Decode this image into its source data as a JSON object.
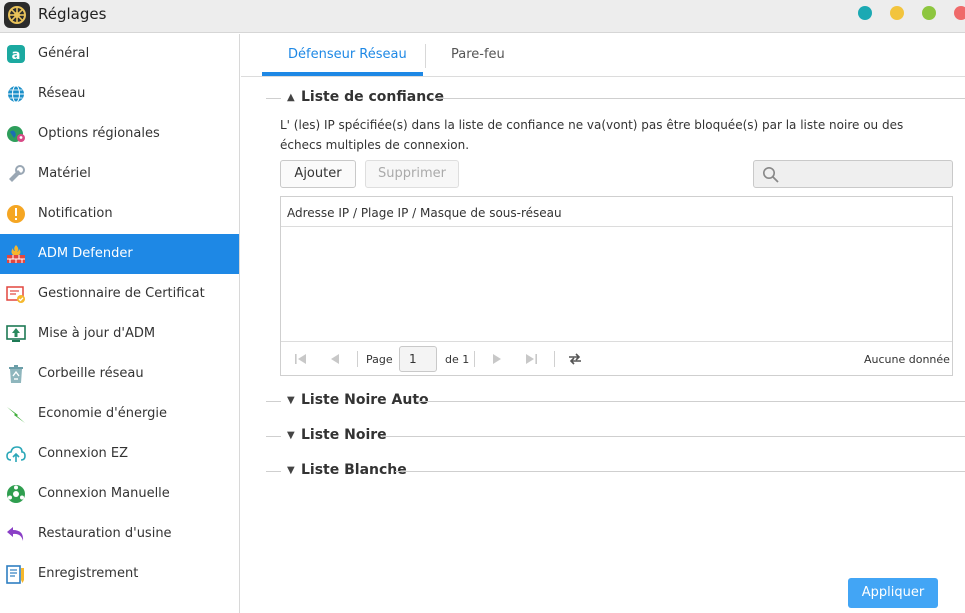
{
  "window": {
    "title": "Réglages",
    "controls": [
      {
        "name": "minimize-dot",
        "color": "#1ba9b3"
      },
      {
        "name": "maximize-dot",
        "color": "#f2c43d"
      },
      {
        "name": "fullscreen-dot",
        "color": "#8dc63f"
      },
      {
        "name": "close-dot",
        "color": "#ef6a6a"
      }
    ]
  },
  "colors": {
    "accent": "#1e88e5",
    "apply": "#42a5f5"
  },
  "sidebar": {
    "items": [
      {
        "label": "Général",
        "icon": "general-icon",
        "active": false
      },
      {
        "label": "Réseau",
        "icon": "globe-icon",
        "active": false
      },
      {
        "label": "Options régionales",
        "icon": "region-icon",
        "active": false
      },
      {
        "label": "Matériel",
        "icon": "hardware-icon",
        "active": false
      },
      {
        "label": "Notification",
        "icon": "notification-icon",
        "active": false
      },
      {
        "label": "ADM Defender",
        "icon": "firewall-icon",
        "active": true
      },
      {
        "label": "Gestionnaire de Certificat",
        "icon": "certificate-icon",
        "active": false
      },
      {
        "label": "Mise à jour d'ADM",
        "icon": "update-icon",
        "active": false
      },
      {
        "label": "Corbeille réseau",
        "icon": "recycle-bin-icon",
        "active": false
      },
      {
        "label": "Economie d'énergie",
        "icon": "energy-icon",
        "active": false
      },
      {
        "label": "Connexion EZ",
        "icon": "cloud-connect-icon",
        "active": false
      },
      {
        "label": "Connexion Manuelle",
        "icon": "manual-connect-icon",
        "active": false
      },
      {
        "label": "Restauration d'usine",
        "icon": "factory-reset-icon",
        "active": false
      },
      {
        "label": "Enregistrement",
        "icon": "registration-icon",
        "active": false
      }
    ]
  },
  "tabs": [
    {
      "label": "Défenseur Réseau",
      "active": true
    },
    {
      "label": "Pare-feu",
      "active": false
    }
  ],
  "sections": {
    "trust": {
      "title": "Liste de confiance",
      "expanded": true,
      "description": "L' (les) IP spécifiée(s) dans la liste de confiance ne va(vont) pas être bloquée(s) par la liste noire ou des échecs multiples de connexion."
    },
    "auto_black": {
      "title": "Liste Noire Auto",
      "expanded": false
    },
    "black": {
      "title": "Liste Noire",
      "expanded": false
    },
    "white": {
      "title": "Liste Blanche",
      "expanded": false
    }
  },
  "toolbar": {
    "add_label": "Ajouter",
    "delete_label": "Supprimer",
    "search_value": ""
  },
  "grid": {
    "column": "Adresse IP / Plage IP / Masque de sous-réseau",
    "rows": []
  },
  "pager": {
    "page_label": "Page",
    "page_value": "1",
    "of_label": "de 1",
    "status": "Aucune donnée"
  },
  "footer": {
    "apply_label": "Appliquer"
  }
}
